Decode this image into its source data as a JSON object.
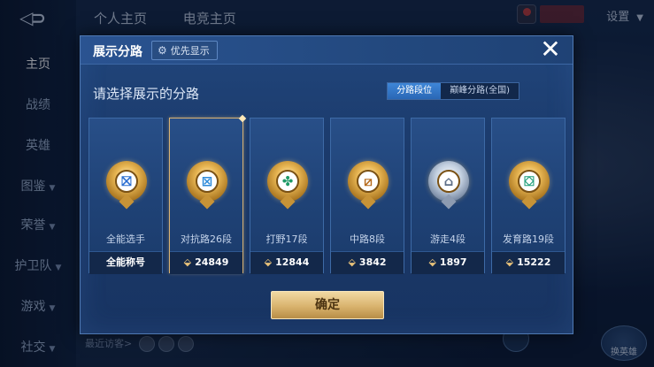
{
  "background": {
    "nav_items": [
      {
        "label": "主页",
        "active": true,
        "has_chevron": false
      },
      {
        "label": "战绩",
        "active": false,
        "has_chevron": false
      },
      {
        "label": "英雄",
        "active": false,
        "has_chevron": false
      },
      {
        "label": "图鉴",
        "active": false,
        "has_chevron": true
      },
      {
        "label": "荣誉",
        "active": false,
        "has_chevron": true
      },
      {
        "label": "护卫队",
        "active": false,
        "has_chevron": true
      },
      {
        "label": "游戏",
        "active": false,
        "has_chevron": true
      },
      {
        "label": "社交",
        "active": false,
        "has_chevron": true
      }
    ],
    "top_tabs": [
      "个人主页",
      "电竞主页"
    ],
    "settings_label": "设置",
    "visitors_label": "最近访客>",
    "right_button_label": "换英雄"
  },
  "modal": {
    "title": "展示分路",
    "pref_button": "优先显示",
    "subtitle": "请选择展示的分路",
    "seg_tabs": [
      {
        "label": "分路段位",
        "active": true
      },
      {
        "label": "巅峰分路(全国)",
        "active": false
      }
    ],
    "cards": [
      {
        "label": "全能选手",
        "stat": "全能称号",
        "has_trophy": false,
        "selected": false,
        "icon": "allround-badge-icon",
        "glyph": "⛝",
        "glyph_color": "#2c6fd1",
        "metal": "gold"
      },
      {
        "label": "对抗路26段",
        "stat": "24849",
        "has_trophy": true,
        "selected": true,
        "icon": "clash-lane-badge-icon",
        "glyph": "⊠",
        "glyph_color": "#2d8ad9",
        "metal": "gold"
      },
      {
        "label": "打野17段",
        "stat": "12844",
        "has_trophy": true,
        "selected": false,
        "icon": "jungle-badge-icon",
        "glyph": "✤",
        "glyph_color": "#1f9a67",
        "metal": "gold"
      },
      {
        "label": "中路8段",
        "stat": "3842",
        "has_trophy": true,
        "selected": false,
        "icon": "mid-lane-badge-icon",
        "glyph": "⧄",
        "glyph_color": "#b56a1c",
        "metal": "gold"
      },
      {
        "label": "游走4段",
        "stat": "1897",
        "has_trophy": true,
        "selected": false,
        "icon": "roam-badge-icon",
        "glyph": "⌂",
        "glyph_color": "#5e6f88",
        "metal": "silver"
      },
      {
        "label": "发育路19段",
        "stat": "15222",
        "has_trophy": true,
        "selected": false,
        "icon": "farm-lane-badge-icon",
        "glyph": "⛋",
        "glyph_color": "#1e9e7a",
        "metal": "gold"
      }
    ],
    "confirm_button": "确定"
  },
  "colors": {
    "accent_gold": "#d9b36e",
    "panel_blue": "#1b3a6b",
    "active_tab_blue": "#2a67b5"
  }
}
